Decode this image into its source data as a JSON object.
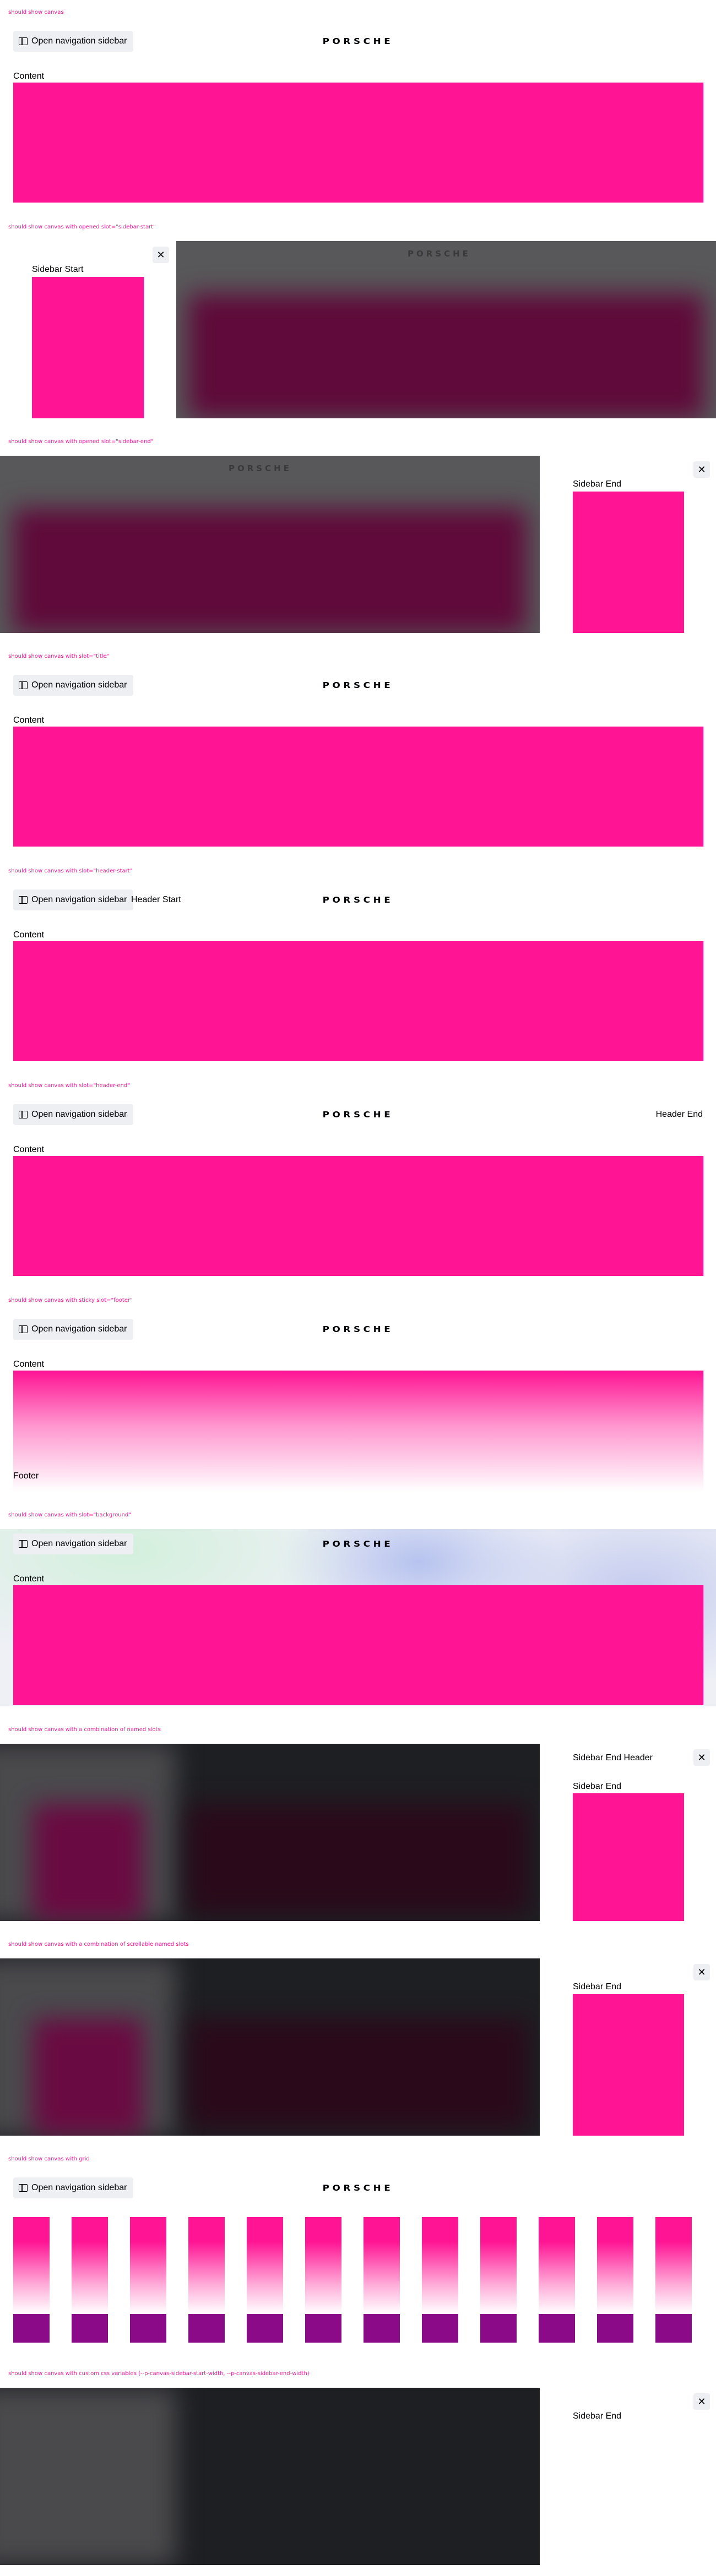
{
  "common": {
    "nav_button_label": "Open navigation sidebar",
    "logo_text": "PORSCHE",
    "content_label": "Content",
    "close_glyph": "✕",
    "accent_color": "#ff1493",
    "icons": [
      "sidebar-icon",
      "close-icon",
      "porsche-logo"
    ]
  },
  "sections": {
    "s1": {
      "caption": "should show canvas"
    },
    "s2": {
      "caption": "should show canvas with opened slot=\"sidebar-start\"",
      "sidebar_label": "Sidebar Start"
    },
    "s3": {
      "caption": "should show canvas with opened slot=\"sidebar-end\"",
      "sidebar_label": "Sidebar End"
    },
    "s4": {
      "caption": "should show canvas with slot=\"title\""
    },
    "s5": {
      "caption": "should show canvas with slot=\"header-start\"",
      "header_label": "Header Start"
    },
    "s6": {
      "caption": "should show canvas with slot=\"header-end\"",
      "header_label": "Header End"
    },
    "s7": {
      "caption": "should show canvas with sticky slot=\"footer\"",
      "footer_label": "Footer"
    },
    "s8": {
      "caption": "should show canvas with slot=\"background\""
    },
    "s9": {
      "caption": "should show canvas with a combination of named slots",
      "sidebar_header_label": "Sidebar End Header",
      "sidebar_label": "Sidebar End"
    },
    "s10": {
      "caption": "should show canvas with a combination of scrollable named slots",
      "sidebar_label": "Sidebar End"
    },
    "s11": {
      "caption": "should show canvas with grid"
    },
    "s12": {
      "caption": "should show canvas with custom css variables (--p-canvas-sidebar-start-width, --p-canvas-sidebar-end-width)",
      "sidebar_label": "Sidebar End"
    }
  }
}
